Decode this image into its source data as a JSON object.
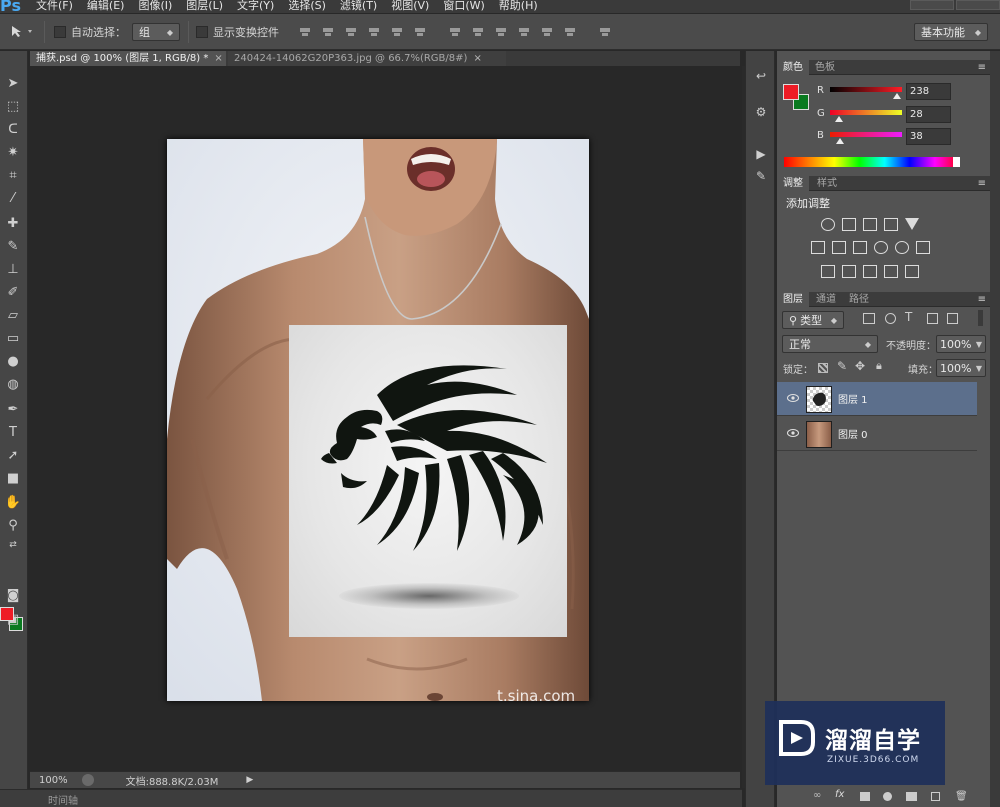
{
  "app": {
    "logo": "Ps"
  },
  "menu": [
    "文件(F)",
    "编辑(E)",
    "图像(I)",
    "图层(L)",
    "文字(Y)",
    "选择(S)",
    "滤镜(T)",
    "视图(V)",
    "窗口(W)",
    "帮助(H)"
  ],
  "options_bar": {
    "auto_select_label": "自动选择：",
    "auto_select_value": "组",
    "show_transform_label": "显示变换控件",
    "workspace": "基本功能"
  },
  "doc_tabs": [
    {
      "title": "捕获.psd @ 100% (图层 1, RGB/8) *"
    },
    {
      "title": "240424-14062G20P363.jpg @ 66.7%(RGB/8#)"
    }
  ],
  "colors": {
    "foreground": "#ee1c26",
    "background": "#0a7a20"
  },
  "color_panel": {
    "tabs": [
      "颜色",
      "色板"
    ],
    "channels": [
      {
        "label": "R",
        "value": "238"
      },
      {
        "label": "G",
        "value": "28"
      },
      {
        "label": "B",
        "value": "38"
      }
    ]
  },
  "adjust_panel": {
    "tabs": [
      "调整",
      "样式"
    ],
    "heading": "添加调整"
  },
  "layers_panel": {
    "tabs": [
      "图层",
      "通道",
      "路径"
    ],
    "filter_label": "类型",
    "blend_mode": "正常",
    "opacity_label": "不透明度：",
    "opacity_value": "100%",
    "lock_label": "锁定：",
    "fill_label": "填充：",
    "fill_value": "100%",
    "layers": [
      {
        "name": "图层 1",
        "selected": true
      },
      {
        "name": "图层 0",
        "selected": false
      }
    ]
  },
  "status": {
    "zoom": "100%",
    "doc_size": "文档:888.8K/2.03M"
  },
  "timeline": {
    "label": "时间轴"
  },
  "watermarks": {
    "sina": "t.sina.com",
    "zixue_title": "溜溜自学",
    "zixue_url": "ZIXUE.3D66.COM"
  }
}
